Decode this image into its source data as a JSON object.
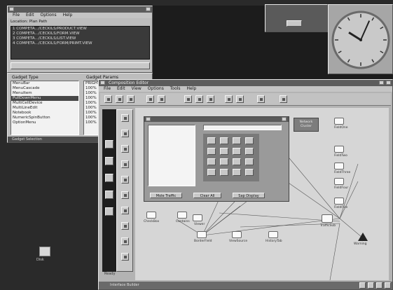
{
  "top_left_window": {
    "title": "",
    "menu": [
      "File",
      "Edit",
      "Options",
      "Help"
    ],
    "location_label": "Location: Plan Path",
    "files": [
      "1  COMPETA.../CECKILS/PRODUCT.VIEW",
      "2  COMPETA.../CECKILS/FORM.VIEW",
      "3  COMPETA.../CECKILS/LIST.VIEW",
      "4  COMPETA.../CECKILS/FORM/PRIMT.VIEW"
    ]
  },
  "gadgets_panel": {
    "left_header": "Gadget Type",
    "right_header": "Gadget Params",
    "left_items": [
      "MenuBar",
      "MenuCascade",
      "MenuItem",
      "PullDownMenu",
      "MultiCellDevice",
      "MultiLineEdit",
      "Notebook",
      "NumericSpinButton",
      "OptionMenu"
    ],
    "selected_index": 3,
    "right_items": [
      "PRIGHTWIDTH",
      "100%",
      "100%",
      "100%",
      "100%",
      "100%",
      "100%",
      "100%",
      "100%"
    ],
    "footer": "Gadget Selection"
  },
  "clock": {
    "hour": 10,
    "minute": 4
  },
  "builder_window": {
    "title": "Composition Editor",
    "menu": [
      "File",
      "Edit",
      "View",
      "Options",
      "Tools",
      "Help"
    ],
    "status": "Ready",
    "bottom_label": "Interface Builder"
  },
  "dialog": {
    "buttons": [
      "Mole Traffic",
      "Clear All",
      "Sap Display"
    ]
  },
  "canvas": {
    "box_label": "Network Cluster",
    "nodes": [
      "FieldOne",
      "FieldTwo",
      "FieldThree",
      "FieldFour",
      "FieldFive",
      "TrafficSub",
      "CheckBox",
      "Contains",
      "BorderField",
      "ViewSource",
      "HistoryTab",
      "Warning",
      "Viewer"
    ]
  },
  "desktop_icon_label": "Disk",
  "colors": {
    "desktop": "#2a2a2a",
    "window_gray": "#bdbdbd",
    "titlebar": "#5c5c5c",
    "list_selection": "#474747"
  }
}
